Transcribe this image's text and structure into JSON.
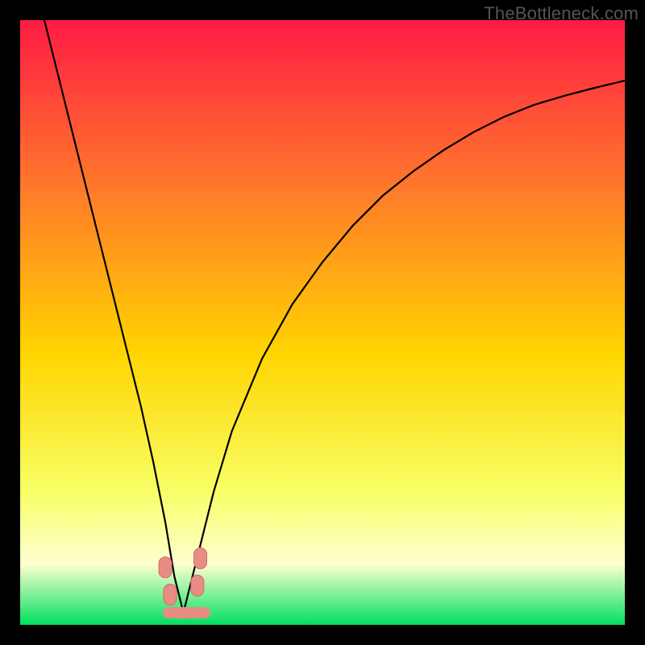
{
  "watermark": "TheBottleneck.com",
  "colors": {
    "page_bg": "#000000",
    "gradient_top": "#ff1b44",
    "gradient_mid_upper": "#ff7a2a",
    "gradient_mid": "#ffd400",
    "gradient_lower": "#f8ff66",
    "gradient_pale": "#fdffd0",
    "gradient_bottom": "#00e060",
    "curve": "#000000",
    "marker_fill": "#e98c84",
    "marker_stroke": "#cc6e66"
  },
  "chart_data": {
    "type": "line",
    "title": "",
    "xlabel": "",
    "ylabel": "",
    "x_range": [
      0,
      100
    ],
    "y_range": [
      0,
      100
    ],
    "sweet_spot_x": 27,
    "series": [
      {
        "name": "bottleneck-curve",
        "x": [
          4,
          6,
          8,
          10,
          12,
          14,
          16,
          18,
          20,
          22,
          24,
          25.5,
          27,
          28.5,
          30,
          32,
          35,
          40,
          45,
          50,
          55,
          60,
          65,
          70,
          75,
          80,
          85,
          90,
          95,
          100
        ],
        "y": [
          100,
          92,
          84,
          76,
          68,
          60,
          52,
          44,
          36,
          27,
          17,
          8,
          2,
          8,
          14,
          22,
          32,
          44,
          53,
          60,
          66,
          71,
          75,
          78.5,
          81.5,
          84,
          86,
          87.5,
          88.8,
          90
        ]
      }
    ],
    "markers": [
      {
        "name": "left-marker-top",
        "x": 24.0,
        "y": 9.5
      },
      {
        "name": "left-marker-bottom",
        "x": 24.8,
        "y": 5.0
      },
      {
        "name": "right-marker-top",
        "x": 29.8,
        "y": 11.0
      },
      {
        "name": "right-marker-bottom",
        "x": 29.3,
        "y": 6.5
      }
    ],
    "baseline_segment": {
      "x0": 24.5,
      "x1": 30.5,
      "y": 2.0
    }
  }
}
